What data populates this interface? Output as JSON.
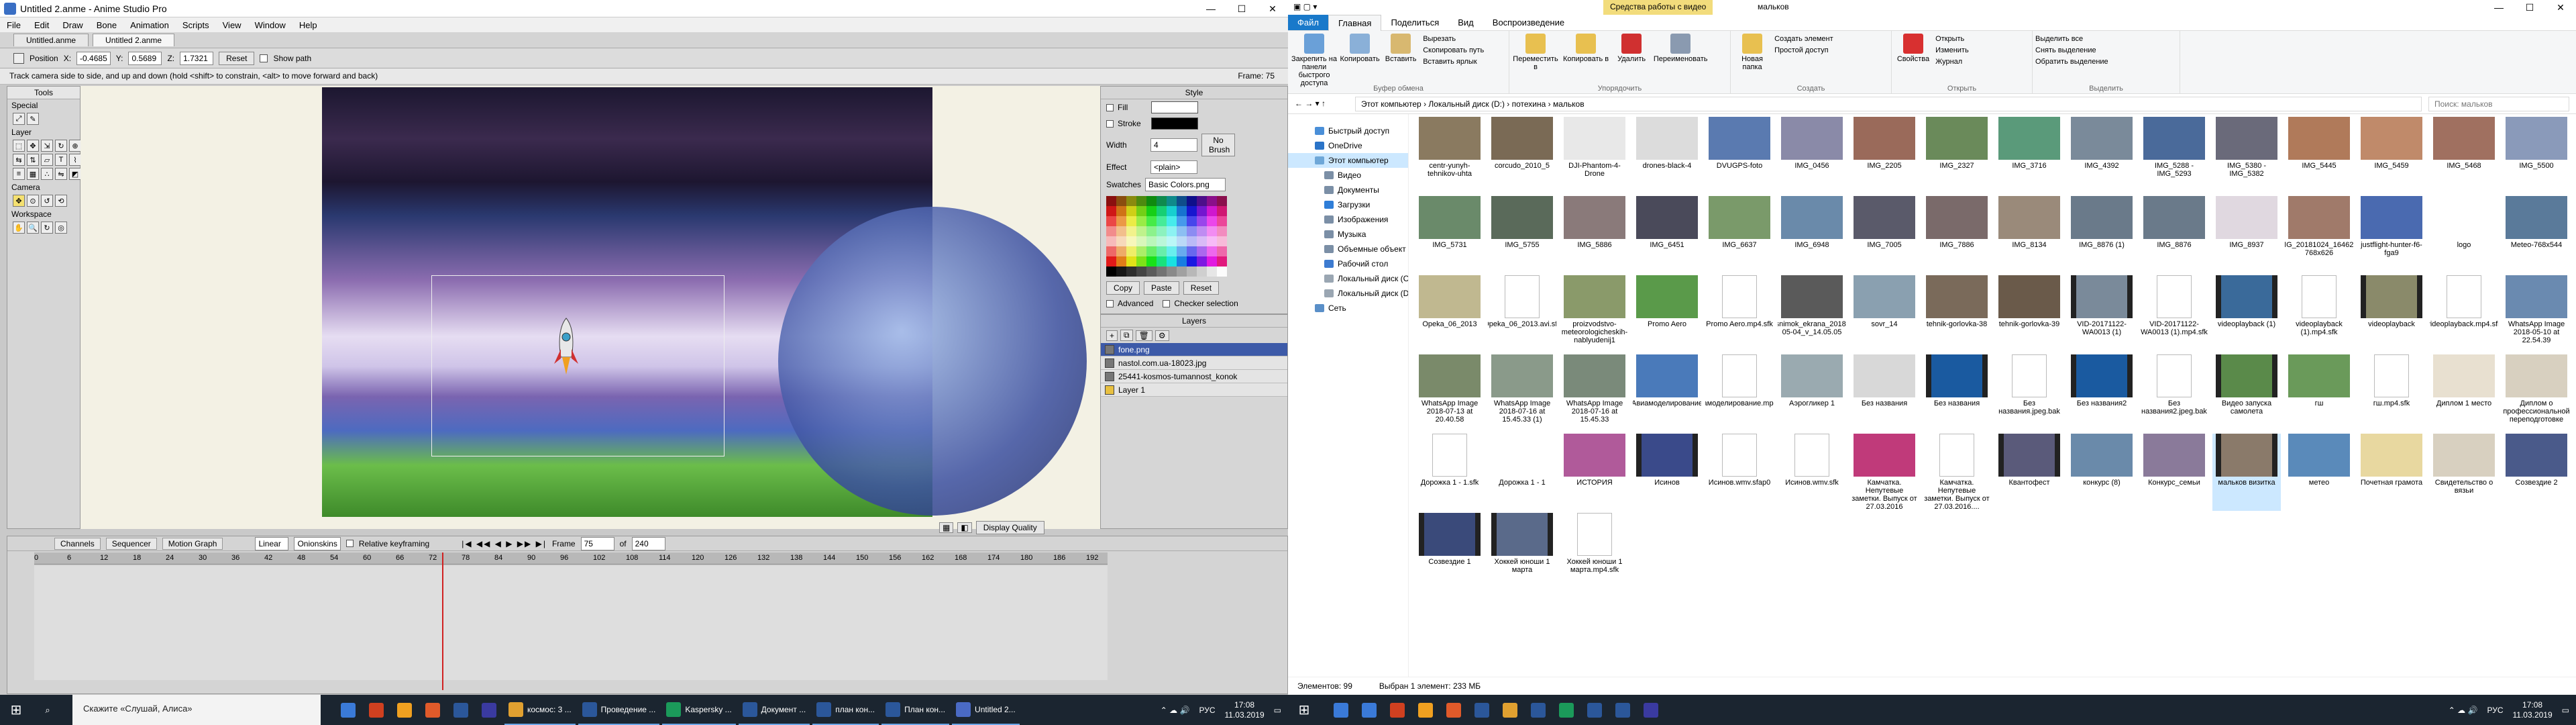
{
  "anime": {
    "title": "Untitled 2.anme - Anime Studio Pro",
    "menu": [
      "File",
      "Edit",
      "Draw",
      "Bone",
      "Animation",
      "Scripts",
      "View",
      "Window",
      "Help"
    ],
    "doc_tabs": [
      "Untitled.anme",
      "Untitled 2.anme"
    ],
    "tool_opts": {
      "label": "Position",
      "x_lbl": "X:",
      "x": "-0.4685",
      "y_lbl": "Y:",
      "y": "0.5689",
      "z_lbl": "Z:",
      "z": "1.7321",
      "reset": "Reset",
      "show_path": "Show path"
    },
    "hint": "Track camera side to side, and up and down (hold <shift> to constrain, <alt> to move forward and back)",
    "frame_label": "Frame: 75",
    "tools": {
      "title": "Tools",
      "special": "Special",
      "layer": "Layer",
      "camera": "Camera",
      "workspace": "Workspace"
    },
    "style": {
      "title": "Style",
      "fill": "Fill",
      "stroke": "Stroke",
      "width_lbl": "Width",
      "width": "4",
      "effect_lbl": "Effect",
      "effect": "<plain>",
      "no_brush": "No Brush",
      "swatches": "Swatches",
      "swatch_set": "Basic Colors.png",
      "copy": "Copy",
      "paste": "Paste",
      "reset": "Reset",
      "advanced": "Advanced",
      "checker": "Checker selection"
    },
    "layers": {
      "title": "Layers",
      "items": [
        "fone.png",
        "nastol.com.ua-18023.jpg",
        "25441-kosmos-tumannost_konok",
        "Layer 1"
      ]
    },
    "viewbar": {
      "quality": "Display Quality"
    },
    "timeline": {
      "tabs": [
        "Channels",
        "Sequencer",
        "Motion Graph"
      ],
      "interp": "Linear",
      "onionskins": "Onionskins",
      "relative": "Relative keyframing",
      "frame_lbl": "Frame",
      "frame": "75",
      "of_lbl": "of",
      "total": "240",
      "ruler": [
        "0",
        "6",
        "12",
        "18",
        "24",
        "30",
        "36",
        "42",
        "48",
        "54",
        "60",
        "66",
        "72",
        "78",
        "84",
        "90",
        "96",
        "102",
        "108",
        "114",
        "120",
        "126",
        "132",
        "138",
        "144",
        "150",
        "156",
        "162",
        "168",
        "174",
        "180",
        "186",
        "192"
      ]
    }
  },
  "explorer": {
    "context_tab": "Средства работы с видео",
    "title": "мальков",
    "ribbon_tabs": [
      "Файл",
      "Главная",
      "Поделиться",
      "Вид",
      "Воспроизведение"
    ],
    "ribbon": {
      "pin": "Закрепить на панели быстрого доступа",
      "copy": "Копировать",
      "paste": "Вставить",
      "cut": "Вырезать",
      "copy_path": "Скопировать путь",
      "paste_link": "Вставить ярлык",
      "g1": "Буфер обмена",
      "move": "Переместить в",
      "copyto": "Копировать в",
      "delete": "Удалить",
      "rename": "Переименовать",
      "g2": "Упорядочить",
      "newfolder": "Новая папка",
      "newitem": "Создать элемент",
      "easy": "Простой доступ",
      "g3": "Создать",
      "props": "Свойства",
      "open": "Открыть",
      "edit": "Изменить",
      "history": "Журнал",
      "g4": "Открыть",
      "selall": "Выделить все",
      "selnone": "Снять выделение",
      "invert": "Обратить выделение",
      "g5": "Выделить"
    },
    "address": "Этот компьютер  ›  Локальный диск (D:)  ›  потехина  ›  мальков",
    "search": "Поиск: мальков",
    "nav": [
      {
        "label": "Быстрый доступ",
        "sub": false,
        "sel": false,
        "c": "#4a8fd8"
      },
      {
        "label": "OneDrive",
        "sub": false,
        "sel": false,
        "c": "#2b74c8"
      },
      {
        "label": "Этот компьютер",
        "sub": false,
        "sel": true,
        "c": "#6ea7d8"
      },
      {
        "label": "Видео",
        "sub": true,
        "sel": false,
        "c": "#7b8fa6"
      },
      {
        "label": "Документы",
        "sub": true,
        "sel": false,
        "c": "#7b8fa6"
      },
      {
        "label": "Загрузки",
        "sub": true,
        "sel": false,
        "c": "#2f7ed8"
      },
      {
        "label": "Изображения",
        "sub": true,
        "sel": false,
        "c": "#7b8fa6"
      },
      {
        "label": "Музыка",
        "sub": true,
        "sel": false,
        "c": "#7b8fa6"
      },
      {
        "label": "Объемные объект",
        "sub": true,
        "sel": false,
        "c": "#7b8fa6"
      },
      {
        "label": "Рабочий стол",
        "sub": true,
        "sel": false,
        "c": "#3d7bd0"
      },
      {
        "label": "Локальный диск (C",
        "sub": true,
        "sel": false,
        "c": "#9aa6b2"
      },
      {
        "label": "Локальный диск (D",
        "sub": true,
        "sel": false,
        "c": "#9aa6b2"
      },
      {
        "label": "Сеть",
        "sub": false,
        "sel": false,
        "c": "#5a8fc8"
      }
    ],
    "files": [
      {
        "n": "centr-yunyh-tehnikov-uhta",
        "k": "img",
        "c": "#8a7a60"
      },
      {
        "n": "corcudo_2010_5",
        "k": "img",
        "c": "#7a6a55"
      },
      {
        "n": "DJI-Phantom-4-Drone",
        "k": "img",
        "c": "#e8e8e8"
      },
      {
        "n": "drones-black-4",
        "k": "img",
        "c": "#dcdcdc"
      },
      {
        "n": "DVUGPS-foto",
        "k": "img",
        "c": "#5a7ab0"
      },
      {
        "n": "IMG_0456",
        "k": "img",
        "c": "#8a8aa8"
      },
      {
        "n": "IMG_2205",
        "k": "img",
        "c": "#9a6a5a"
      },
      {
        "n": "IMG_2327",
        "k": "img",
        "c": "#6a8a5a"
      },
      {
        "n": "IMG_3716",
        "k": "img",
        "c": "#5a9a7a"
      },
      {
        "n": "IMG_4392",
        "k": "img",
        "c": "#7a8a9a"
      },
      {
        "n": "IMG_5288 - IMG_5293",
        "k": "img",
        "c": "#4a6a9a"
      },
      {
        "n": "IMG_5380 - IMG_5382",
        "k": "img",
        "c": "#6a6a7a"
      },
      {
        "n": "IMG_5445",
        "k": "img",
        "c": "#b07a5a"
      },
      {
        "n": "IMG_5459",
        "k": "img",
        "c": "#c08a6a"
      },
      {
        "n": "IMG_5468",
        "k": "img",
        "c": "#a07060"
      },
      {
        "n": "IMG_5500",
        "k": "img",
        "c": "#8a9aba"
      },
      {
        "n": "",
        "k": "none",
        "c": ""
      },
      {
        "n": "IMG_5731",
        "k": "img",
        "c": "#6a8a6a"
      },
      {
        "n": "IMG_5755",
        "k": "img",
        "c": "#5a6a5a"
      },
      {
        "n": "IMG_5886",
        "k": "img",
        "c": "#8a7a7a"
      },
      {
        "n": "IMG_6451",
        "k": "img",
        "c": "#4a4a5a"
      },
      {
        "n": "IMG_6637",
        "k": "img",
        "c": "#7a9a6a"
      },
      {
        "n": "IMG_6948",
        "k": "img",
        "c": "#6a8aaa"
      },
      {
        "n": "IMG_7005",
        "k": "img",
        "c": "#5a5a6a"
      },
      {
        "n": "IMG_7886",
        "k": "img",
        "c": "#7a6a6a"
      },
      {
        "n": "IMG_8134",
        "k": "img",
        "c": "#9a8a7a"
      },
      {
        "n": "IMG_8876 (1)",
        "k": "img",
        "c": "#6a7a8a"
      },
      {
        "n": "IMG_8876",
        "k": "img",
        "c": "#6a7a8a"
      },
      {
        "n": "IMG_8937",
        "k": "img",
        "c": "#e0d8e0"
      },
      {
        "n": "IMG_20181024_164626-768x626",
        "k": "img",
        "c": "#a07a6a"
      },
      {
        "n": "justflight-hunter-f6-fga9",
        "k": "img",
        "c": "#4a6ab0"
      },
      {
        "n": "logo",
        "k": "img",
        "c": "#ffffff"
      },
      {
        "n": "Meteo-768x544",
        "k": "img",
        "c": "#5a7a9a"
      },
      {
        "n": "",
        "k": "none",
        "c": ""
      },
      {
        "n": "Opeka_06_2013",
        "k": "img",
        "c": "#c0b890"
      },
      {
        "n": "Opeka_06_2013.avi.sfk",
        "k": "doc",
        "c": ""
      },
      {
        "n": "proizvodstvo-meteorologicheskih-nablyudenij1",
        "k": "img",
        "c": "#8a9a6a"
      },
      {
        "n": "Promo Aero",
        "k": "img",
        "c": "#5a9a4a"
      },
      {
        "n": "Promo Aero.mp4.sfk",
        "k": "doc",
        "c": ""
      },
      {
        "n": "snimok_ekrana_2018-05-04_v_14.05.05",
        "k": "img",
        "c": "#5a5a5a"
      },
      {
        "n": "sovr_14",
        "k": "img",
        "c": "#8aa0b0"
      },
      {
        "n": "tehnik-gorlovka-38",
        "k": "img",
        "c": "#7a6a5a"
      },
      {
        "n": "tehnik-gorlovka-39",
        "k": "img",
        "c": "#6a5a4a"
      },
      {
        "n": "VID-20171122-WA0013 (1)",
        "k": "vid",
        "c": "#7a8a9a"
      },
      {
        "n": "VID-20171122-WA0013 (1).mp4.sfk",
        "k": "doc",
        "c": ""
      },
      {
        "n": "videoplayback (1)",
        "k": "vid",
        "c": "#3a6a9a"
      },
      {
        "n": "videoplayback (1).mp4.sfk",
        "k": "doc",
        "c": ""
      },
      {
        "n": "videoplayback",
        "k": "vid",
        "c": "#8a8a6a"
      },
      {
        "n": "videoplayback.mp4.sfk",
        "k": "doc",
        "c": ""
      },
      {
        "n": "WhatsApp Image 2018-05-10 at 22.54.39",
        "k": "img",
        "c": "#6a8ab0"
      },
      {
        "n": "",
        "k": "none",
        "c": ""
      },
      {
        "n": "WhatsApp Image 2018-07-13 at 20.40.58",
        "k": "img",
        "c": "#7a8a6a"
      },
      {
        "n": "WhatsApp Image 2018-07-16 at 15.45.33 (1)",
        "k": "img",
        "c": "#8a9a8a"
      },
      {
        "n": "WhatsApp Image 2018-07-16 at 15.45.33",
        "k": "img",
        "c": "#7a8a7a"
      },
      {
        "n": "Авиамоделирование",
        "k": "img",
        "c": "#4a7aba"
      },
      {
        "n": "Авиамоделирование.mp4.sfk",
        "k": "doc",
        "c": ""
      },
      {
        "n": "Аэрогликер 1",
        "k": "img",
        "c": "#9aaab0"
      },
      {
        "n": "Без названия",
        "k": "img",
        "c": "#d8d8d8"
      },
      {
        "n": "Без названия",
        "k": "vid",
        "c": "#1a5aa0"
      },
      {
        "n": "Без названия.jpeg.bak",
        "k": "doc",
        "c": ""
      },
      {
        "n": "Без названия2",
        "k": "vid",
        "c": "#1a5aa0"
      },
      {
        "n": "Без названия2.jpeg.bak",
        "k": "doc",
        "c": ""
      },
      {
        "n": "Видео запуска самолета",
        "k": "vid",
        "c": "#5a8a4a"
      },
      {
        "n": "гш",
        "k": "img",
        "c": "#6a9a5a"
      },
      {
        "n": "гш.mp4.sfk",
        "k": "doc",
        "c": ""
      },
      {
        "n": "Диплом 1 место",
        "k": "img",
        "c": "#e8e0d0"
      },
      {
        "n": "Диплом о профессиональной переподготовке",
        "k": "img",
        "c": "#d8d0c0"
      },
      {
        "n": "",
        "k": "none",
        "c": ""
      },
      {
        "n": "Дорожка 1 - 1.sfk",
        "k": "doc",
        "c": ""
      },
      {
        "n": "Дорожка 1 - 1",
        "k": "img",
        "c": "#ffffff"
      },
      {
        "n": "ИСТОРИЯ",
        "k": "img",
        "c": "#b05a9a"
      },
      {
        "n": "Исинов",
        "k": "vid",
        "c": "#3a4a8a"
      },
      {
        "n": "Исинов.wmv.sfap0",
        "k": "doc",
        "c": ""
      },
      {
        "n": "Исинов.wmv.sfk",
        "k": "doc",
        "c": ""
      },
      {
        "n": "Камчатка. Непутевые заметки. Выпуск от 27.03.2016",
        "k": "img",
        "c": "#c03a7a"
      },
      {
        "n": "Камчатка. Непутевые заметки. Выпуск от 27.03.2016....",
        "k": "doc",
        "c": ""
      },
      {
        "n": "Квантофест",
        "k": "vid",
        "c": "#5a5a7a"
      },
      {
        "n": "конкурс (8)",
        "k": "img",
        "c": "#6a8aaa"
      },
      {
        "n": "Конкурс_семьи",
        "k": "img",
        "c": "#8a7a9a"
      },
      {
        "n": "мальков визитка",
        "k": "vid",
        "c": "#8a7a6a",
        "sel": true
      },
      {
        "n": "метео",
        "k": "img",
        "c": "#5a8aba"
      },
      {
        "n": "Почетная грамота",
        "k": "img",
        "c": "#e8d8a0"
      },
      {
        "n": "Свидетельство о вязьи",
        "k": "img",
        "c": "#d8d0c0"
      },
      {
        "n": "Созвездие 2",
        "k": "img",
        "c": "#4a5a8a"
      },
      {
        "n": "",
        "k": "none",
        "c": ""
      },
      {
        "n": "Созвездие 1",
        "k": "vid",
        "c": "#3a4a7a"
      },
      {
        "n": "Хоккей юноши 1 марта",
        "k": "vid",
        "c": "#5a6a8a"
      },
      {
        "n": "Хоккей юноши 1 марта.mp4.sfk",
        "k": "doc",
        "c": ""
      }
    ],
    "status": {
      "count": "Элементов: 99",
      "selected": "Выбран 1 элемент: 233 МБ"
    }
  },
  "taskbar": {
    "search": "Скажите «Слушай, Алиса»",
    "apps1": [
      {
        "label": "космос: 3 ...",
        "c": "#e0a030"
      },
      {
        "label": "Проведение ...",
        "c": "#2b579a"
      },
      {
        "label": "Kaspersky ...",
        "c": "#1b9a5a"
      },
      {
        "label": "Документ ...",
        "c": "#2b579a"
      },
      {
        "label": "план кон...",
        "c": "#2b579a"
      },
      {
        "label": "План кон...",
        "c": "#2b579a"
      },
      {
        "label": "Untitled 2...",
        "c": "#4a6ac4"
      }
    ],
    "lang": "РУС",
    "time": "17:08",
    "date": "11.03.2019"
  }
}
